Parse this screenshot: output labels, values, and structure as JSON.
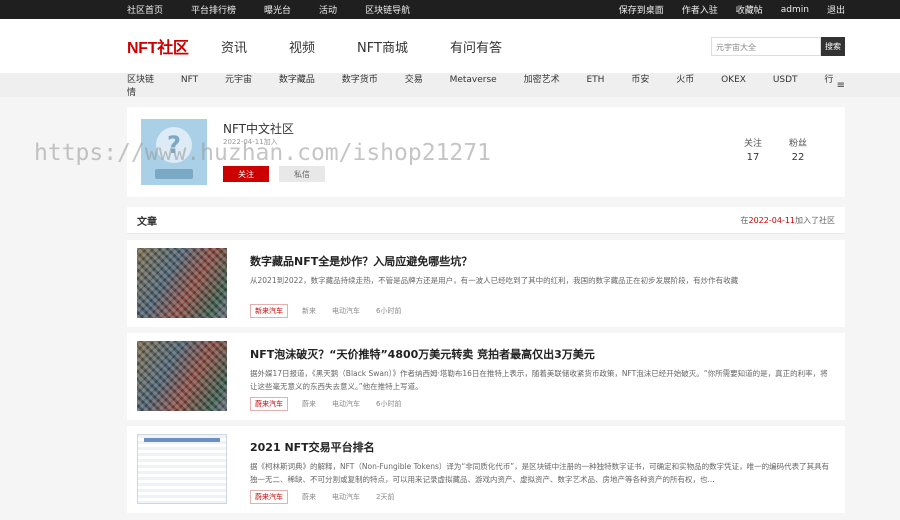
{
  "topbar": {
    "left": [
      "社区首页",
      "平台排行榜",
      "曝光台",
      "活动",
      "区块链导航"
    ],
    "right": [
      "保存到桌面",
      "作者入驻",
      "收藏帖",
      "admin",
      "退出"
    ]
  },
  "header": {
    "logo": "NFT社区",
    "nav": [
      "资讯",
      "视频",
      "NFT商城",
      "有问有答"
    ],
    "search_placeholder": "元宇宙大全",
    "search_button": "搜索"
  },
  "categories": {
    "items": [
      "区块链",
      "NFT",
      "元宇宙",
      "数字藏品",
      "数字货币",
      "交易",
      "Metaverse",
      "加密艺术",
      "ETH",
      "币安",
      "火币",
      "OKEX",
      "USDT",
      "行情"
    ],
    "menu_icon": "≡"
  },
  "profile": {
    "avatar_glyph": "?",
    "name": "NFT中文社区",
    "joined": "2022-04-11加入",
    "follow_label": "关注",
    "message_label": "私信",
    "stats": [
      {
        "label": "关注",
        "value": "17"
      },
      {
        "label": "粉丝",
        "value": "22"
      }
    ]
  },
  "articles_section": {
    "title": "文章",
    "joined_prefix": "在",
    "joined_date": "2022-04-11",
    "joined_suffix": "加入了社区"
  },
  "articles": [
    {
      "title": "数字藏品NFT全是炒作？入局应避免哪些坑？",
      "excerpt": "从2021到2022，数字藏品持续走热，不管是品牌方还是用户，有一波人已经吃到了其中的红利，我国的数字藏品正在初步发展阶段，有炒作有收藏",
      "category": "新来汽车",
      "tag1": "新来",
      "tag2": "电动汽车",
      "time": "6小时前"
    },
    {
      "title": "NFT泡沫破灭？“天价推特”4800万美元转卖 竞拍者最高仅出3万美元",
      "excerpt": "据外媒17日报道，《黑天鹅（Black Swan）》作者纳西姆·塔勒布16日在推特上表示，随着美联储收紧货币政策，NFT泡沫已经开始破灭。“你所需要知道的是，真正的利率，将让这些毫无意义的东西失去意义。”他在推特上写道。",
      "category": "蔚来汽车",
      "tag1": "蔚来",
      "tag2": "电动汽车",
      "time": "6小时前"
    },
    {
      "title": "2021 NFT交易平台排名",
      "excerpt": "据《柯林斯词典》的解释，NFT（Non-Fungible Tokens）译为“非同质化代币”，是区块链中注册的一种独特数字证书，可确定和实物品的数字凭证，唯一的编码代表了其具有独一无二、稀缺、不可分割或复制的特点，可以用来记录虚拟藏品、游戏内资产、虚拟资产、数字艺术品、房地产等各种资产的所有权，也...",
      "category": "蔚来汽车",
      "tag1": "蔚来",
      "tag2": "电动汽车",
      "time": "2天前"
    }
  ],
  "watermark": "https://www.huzhan.com/ishop21271"
}
